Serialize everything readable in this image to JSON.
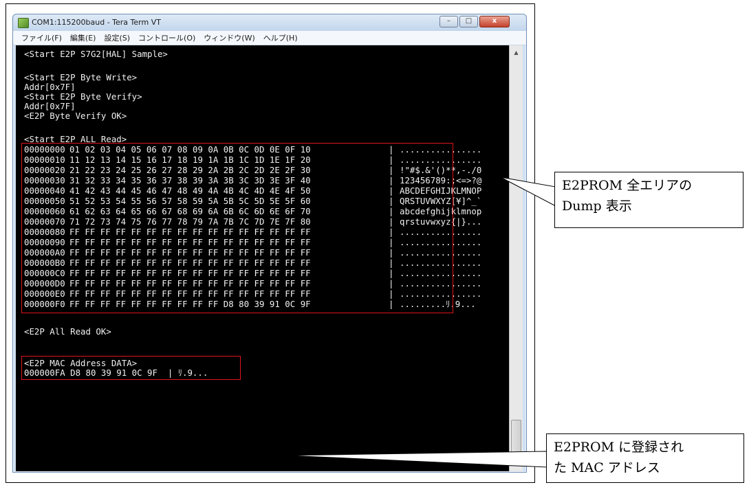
{
  "window": {
    "title": "COM1:115200baud - Tera Term VT",
    "controls": {
      "minimize": "–",
      "maximize": "□",
      "close": "x"
    }
  },
  "menu": [
    "ファイル(F)",
    "編集(E)",
    "設定(S)",
    "コントロール(O)",
    "ウィンドウ(W)",
    "ヘルプ(H)"
  ],
  "terminal": {
    "lines": [
      "<Start E2P S7G2[HAL] Sample>",
      "",
      "<Start E2P Byte Write>",
      "Addr[0x7F]",
      "<Start E2P Byte Verify>",
      "Addr[0x7F]",
      "<E2P Byte Verify OK>",
      "",
      "<Start E2P ALL Read>"
    ],
    "dump": [
      {
        "addr": "00000000",
        "hex": "01 02 03 04 05 06 07 08 09 0A 0B 0C 0D 0E 0F 10",
        "ascii": "................"
      },
      {
        "addr": "00000010",
        "hex": "11 12 13 14 15 16 17 18 19 1A 1B 1C 1D 1E 1F 20",
        "ascii": "................"
      },
      {
        "addr": "00000020",
        "hex": "21 22 23 24 25 26 27 28 29 2A 2B 2C 2D 2E 2F 30",
        "ascii": "!\"#$.&'()**,-./0"
      },
      {
        "addr": "00000030",
        "hex": "31 32 33 34 35 36 37 38 39 3A 3B 3C 3D 3E 3F 40",
        "ascii": "123456789:;<=>?@"
      },
      {
        "addr": "00000040",
        "hex": "41 42 43 44 45 46 47 48 49 4A 4B 4C 4D 4E 4F 50",
        "ascii": "ABCDEFGHIJKLMNOP"
      },
      {
        "addr": "00000050",
        "hex": "51 52 53 54 55 56 57 58 59 5A 5B 5C 5D 5E 5F 60",
        "ascii": "QRSTUVWXYZ[¥]^_`"
      },
      {
        "addr": "00000060",
        "hex": "61 62 63 64 65 66 67 68 69 6A 6B 6C 6D 6E 6F 70",
        "ascii": "abcdefghijklmnop"
      },
      {
        "addr": "00000070",
        "hex": "71 72 73 74 75 76 77 78 79 7A 7B 7C 7D 7E 7F 80",
        "ascii": "qrstuvwxyz{|}..."
      },
      {
        "addr": "00000080",
        "hex": "FF FF FF FF FF FF FF FF FF FF FF FF FF FF FF FF",
        "ascii": "................"
      },
      {
        "addr": "00000090",
        "hex": "FF FF FF FF FF FF FF FF FF FF FF FF FF FF FF FF",
        "ascii": "................"
      },
      {
        "addr": "000000A0",
        "hex": "FF FF FF FF FF FF FF FF FF FF FF FF FF FF FF FF",
        "ascii": "................"
      },
      {
        "addr": "000000B0",
        "hex": "FF FF FF FF FF FF FF FF FF FF FF FF FF FF FF FF",
        "ascii": "................"
      },
      {
        "addr": "000000C0",
        "hex": "FF FF FF FF FF FF FF FF FF FF FF FF FF FF FF FF",
        "ascii": "................"
      },
      {
        "addr": "000000D0",
        "hex": "FF FF FF FF FF FF FF FF FF FF FF FF FF FF FF FF",
        "ascii": "................"
      },
      {
        "addr": "000000E0",
        "hex": "FF FF FF FF FF FF FF FF FF FF FF FF FF FF FF FF",
        "ascii": "................"
      },
      {
        "addr": "000000F0",
        "hex": "FF FF FF FF FF FF FF FF FF FF D8 80 39 91 0C 9F",
        "ascii": ".........ﾘ.9..."
      }
    ],
    "dump_separator": "|",
    "all_read_ok": "<E2P All Read OK>",
    "mac_header": "<E2P MAC Address DATA>",
    "mac_line": "000000FA D8 80 39 91 0C 9F  | ﾘ.9..."
  },
  "callouts": {
    "dump": [
      "E2PROM 全エリアの",
      "Dump 表示"
    ],
    "mac": [
      "E2PROM に登録され",
      "た MAC アドレス"
    ]
  },
  "colors": {
    "terminal_bg": "#000000",
    "terminal_text": "#f2f2f2",
    "highlight": "#e0141c"
  }
}
